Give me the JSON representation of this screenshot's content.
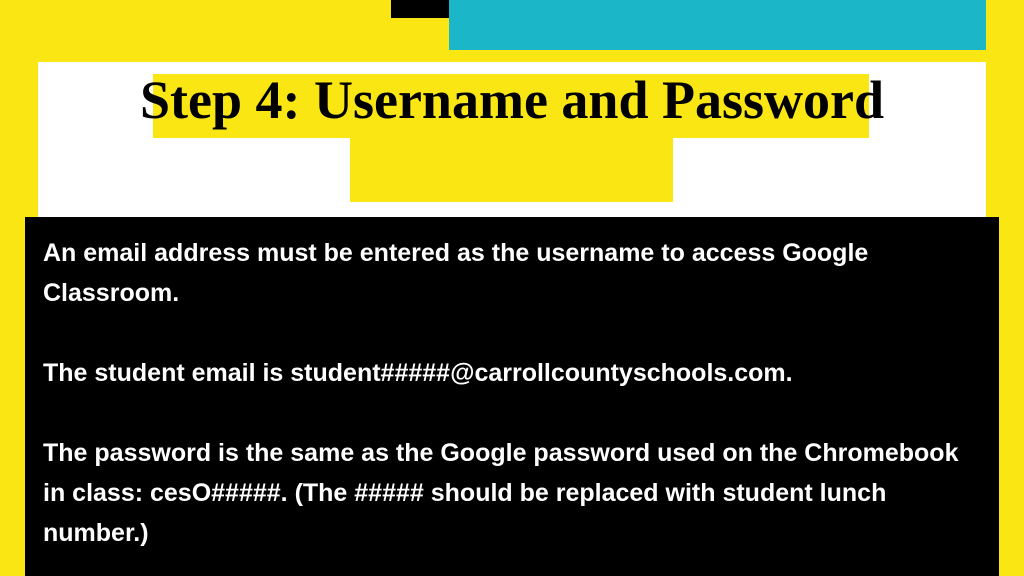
{
  "slide": {
    "title": "Step 4: Username and Password",
    "para1": "An email address must be entered as the username to access Google Classroom.",
    "para2": "The student email is student#####@carrollcountyschools.com.",
    "para3": "The password is the same as the Google password used on the Chromebook in class: cesO#####. (The ##### should be replaced with student lunch number.)"
  }
}
